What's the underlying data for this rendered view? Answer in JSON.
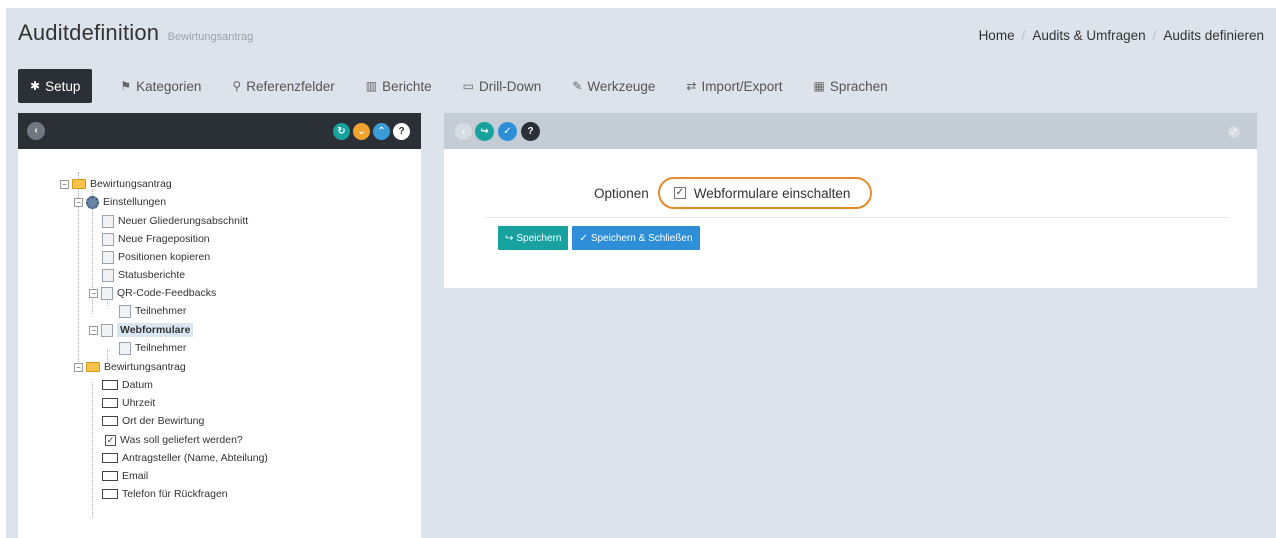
{
  "header": {
    "title": "Auditdefinition",
    "subtitle": "Bewirtungsantrag",
    "breadcrumb": [
      "Home",
      "Audits & Umfragen",
      "Audits definieren"
    ]
  },
  "tabs": [
    {
      "label": "Setup",
      "icon": "gear-icon",
      "glyph": "✱"
    },
    {
      "label": "Kategorien",
      "icon": "flag-icon",
      "glyph": "⚑"
    },
    {
      "label": "Referenzfelder",
      "icon": "search-icon",
      "glyph": "⚲"
    },
    {
      "label": "Berichte",
      "icon": "bar-chart-icon",
      "glyph": "▥"
    },
    {
      "label": "Drill-Down",
      "icon": "folder-icon",
      "glyph": "▭"
    },
    {
      "label": "Werkzeuge",
      "icon": "wrench-icon",
      "glyph": "✎"
    },
    {
      "label": "Import/Export",
      "icon": "exchange-icon",
      "glyph": "⇄"
    },
    {
      "label": "Sprachen",
      "icon": "language-icon",
      "glyph": "▦"
    }
  ],
  "tree": {
    "root": "Bewirtungsantrag",
    "settings": "Einstellungen",
    "settings_items": [
      "Neuer Gliederungsabschnitt",
      "Neue Frageposition",
      "Positionen kopieren",
      "Statusberichte"
    ],
    "qr": "QR-Code-Feedbacks",
    "qr_child": "Teilnehmer",
    "webforms": "Webformulare",
    "webforms_child": "Teilnehmer",
    "form": "Bewirtungsantrag",
    "form_fields": [
      "Datum",
      "Uhrzeit",
      "Ort der Bewirtung",
      "Was soll geliefert werden?",
      "Antragsteller (Name, Abteilung)",
      "Email",
      "Telefon für Rückfragen"
    ]
  },
  "right": {
    "options_label": "Optionen",
    "webform_toggle": "Webformulare einschalten",
    "save": "Speichern",
    "save_close": "Speichern & Schließen"
  },
  "colors": {
    "toolbar_dark": "#2b2f36",
    "teal": "#17a2a0",
    "blue": "#2e8fd8",
    "orange_highlight": "#e58b2b"
  }
}
